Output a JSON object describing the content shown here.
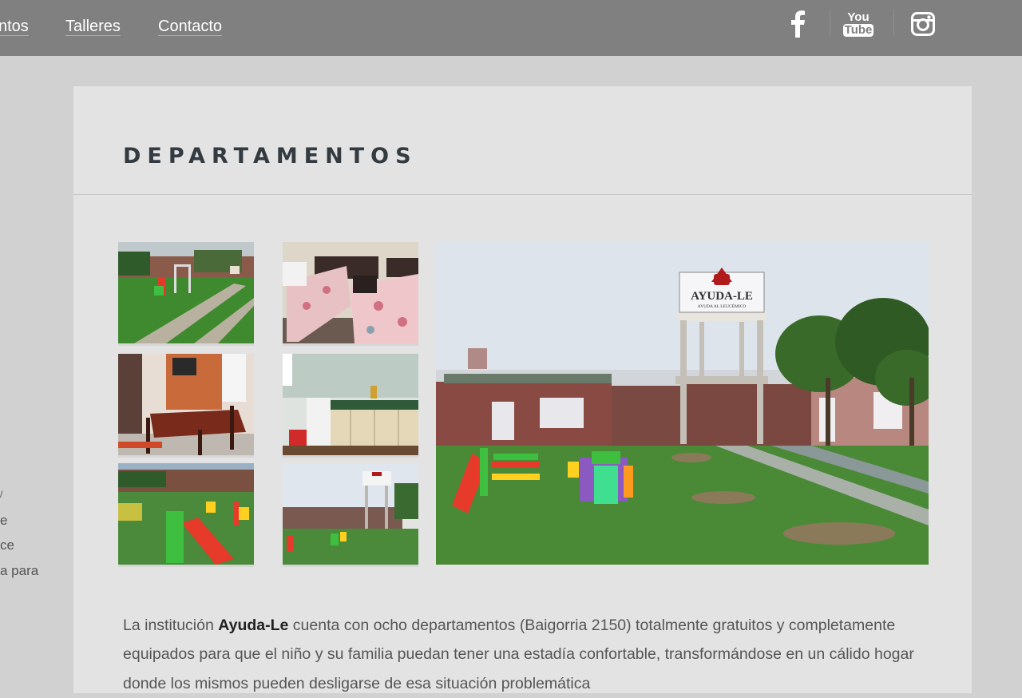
{
  "nav": {
    "items": [
      {
        "label": "ntos"
      },
      {
        "label": "Talleres"
      },
      {
        "label": "Contacto"
      }
    ],
    "social": {
      "facebook_icon": "facebook-icon",
      "youtube": {
        "line1": "You",
        "line2": "Tube"
      },
      "instagram_icon": "instagram-icon"
    }
  },
  "sidebar": {
    "fragments": [
      "e",
      "ce",
      "a para"
    ]
  },
  "page": {
    "title": "DEPARTAMENTOS",
    "paragraph": {
      "before": "La institución ",
      "bold": "Ayuda-Le",
      "after": " cuenta con ocho departamentos (Baigorria 2150) totalmente gratuitos y completamente equipados para que el niño y su familia puedan tener una estadía confortable, transformándose en un cálido hogar donde los mismos pueden desligarse de esa situación problemática"
    }
  },
  "gallery": {
    "sign_name": "AYUDA-LE",
    "sign_tagline": "AYUDA AL LEUCÉMICO"
  },
  "colors": {
    "topbar": "#808080",
    "background": "#d1d1d1",
    "card": "#e3e3e3",
    "title": "#333a40",
    "text": "#555555"
  }
}
